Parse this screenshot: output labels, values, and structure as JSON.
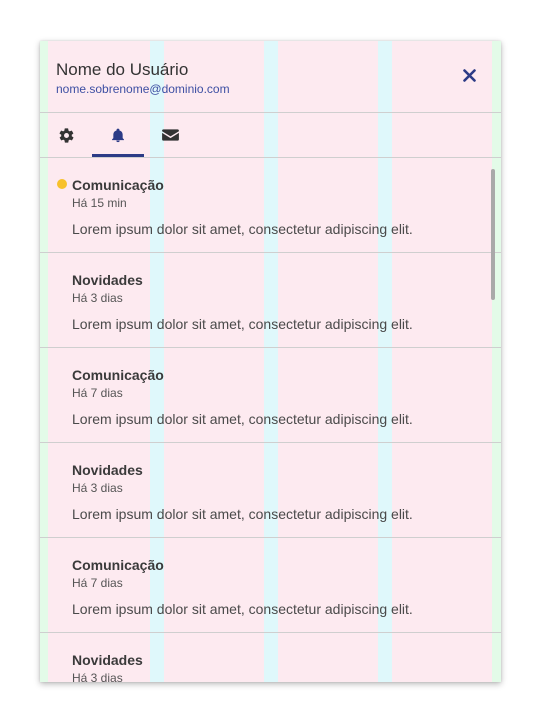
{
  "header": {
    "user_name": "Nome do Usuário",
    "user_email": "nome.sobrenome@dominio.com",
    "close_icon": "close-icon"
  },
  "tabs": [
    {
      "icon": "gear-icon",
      "active": false
    },
    {
      "icon": "bell-icon",
      "active": true
    },
    {
      "icon": "envelope-icon",
      "active": false
    }
  ],
  "notifications": [
    {
      "title": "Comunicação",
      "time": "Há 15 min",
      "body": "Lorem ipsum dolor sit amet, consectetur adipiscing elit.",
      "unread": true
    },
    {
      "title": "Novidades",
      "time": "Há 3 dias",
      "body": "Lorem ipsum dolor sit amet, consectetur adipiscing elit.",
      "unread": false
    },
    {
      "title": "Comunicação",
      "time": "Há 7 dias",
      "body": "Lorem ipsum dolor sit amet, consectetur adipiscing elit.",
      "unread": false
    },
    {
      "title": "Novidades",
      "time": "Há 3 dias",
      "body": "Lorem ipsum dolor sit amet, consectetur adipiscing elit.",
      "unread": false
    },
    {
      "title": "Comunicação",
      "time": "Há 7 dias",
      "body": "Lorem ipsum dolor sit amet, consectetur adipiscing elit.",
      "unread": false
    },
    {
      "title": "Novidades",
      "time": "Há 3 dias",
      "body": "",
      "unread": false
    }
  ],
  "colors": {
    "accent": "#2c3b86",
    "email": "#3d4fa3",
    "unread_dot": "#f7c12b",
    "grid_margin": "#e3fbe8",
    "grid_column": "#fdeaf0",
    "grid_gutter": "#dff8fb"
  }
}
